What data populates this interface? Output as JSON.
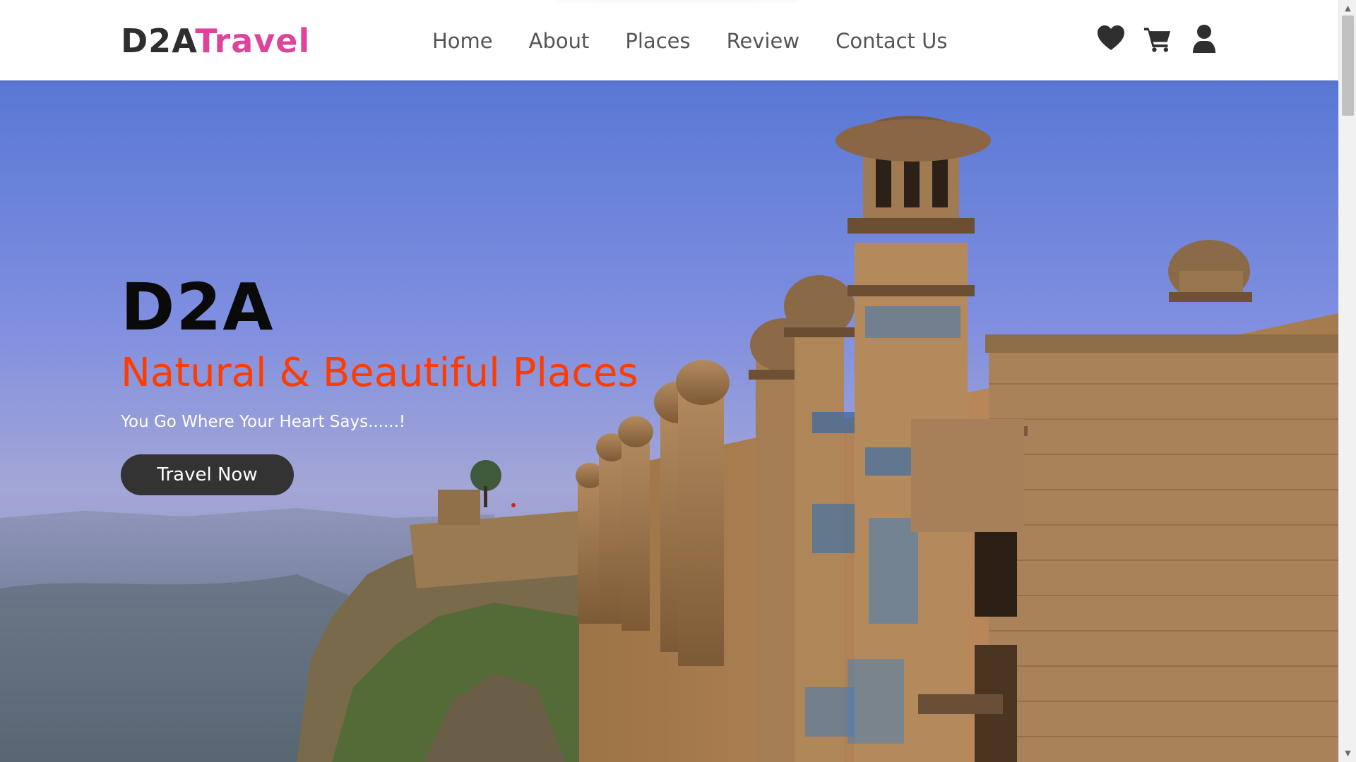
{
  "header": {
    "logo_part1": "D2A",
    "logo_part2": "Travel",
    "nav": [
      "Home",
      "About",
      "Places",
      "Review",
      "Contact Us"
    ],
    "icons": [
      "heart-icon",
      "cart-icon",
      "user-icon"
    ]
  },
  "hero": {
    "title": "D2A",
    "subtitle": "Natural & Beautiful Places",
    "tagline": "You Go Where Your Heart Says......!",
    "button": "Travel Now",
    "image": "photo of a sandstone fort with domed towers on a cliff under blue sky"
  },
  "colors": {
    "brand_dark": "#2e2e2e",
    "brand_pink": "#e0449a",
    "subtitle_orange": "#ff3c00",
    "button_bg": "#333333"
  }
}
